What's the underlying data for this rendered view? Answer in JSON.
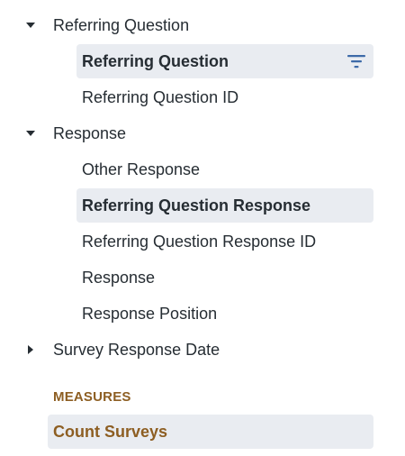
{
  "colors": {
    "text": "#262d33",
    "selected_bg": "#e9ecf1",
    "filter_icon": "#3d6aa8",
    "measure_text": "#8d5e22"
  },
  "dimensions": [
    {
      "label": "Referring Question",
      "expanded": true,
      "caret_icon": "caret-down-icon",
      "fields": [
        {
          "label": "Referring Question",
          "selected": true,
          "filtered": true,
          "icon": "filter-icon"
        },
        {
          "label": "Referring Question ID",
          "selected": false,
          "filtered": false
        }
      ]
    },
    {
      "label": "Response",
      "expanded": true,
      "caret_icon": "caret-down-icon",
      "fields": [
        {
          "label": "Other Response",
          "selected": false,
          "filtered": false
        },
        {
          "label": "Referring Question Response",
          "selected": true,
          "filtered": false
        },
        {
          "label": "Referring Question Response ID",
          "selected": false,
          "filtered": false
        },
        {
          "label": "Response",
          "selected": false,
          "filtered": false
        },
        {
          "label": "Response Position",
          "selected": false,
          "filtered": false
        }
      ]
    },
    {
      "label": "Survey Response Date",
      "expanded": false,
      "caret_icon": "caret-right-icon",
      "fields": []
    }
  ],
  "measures": {
    "header": "MEASURES",
    "items": [
      {
        "label": "Count Surveys",
        "selected": true
      }
    ]
  }
}
